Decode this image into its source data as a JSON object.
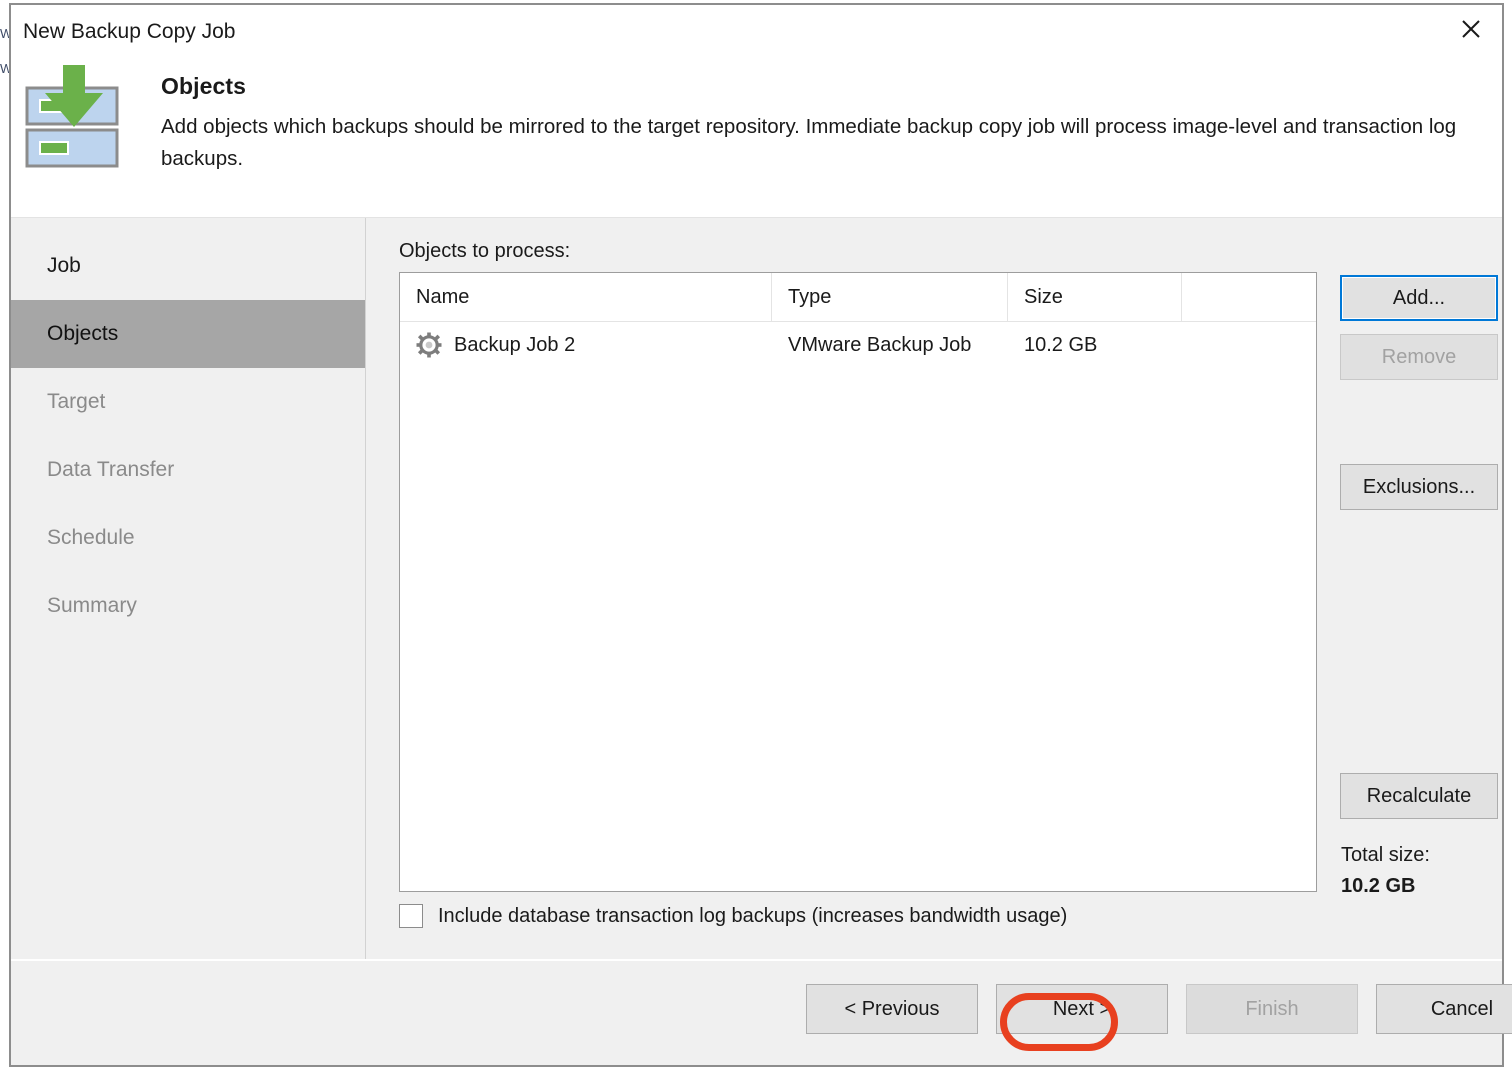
{
  "window": {
    "title": "New Backup Copy Job",
    "close_icon": "close-icon"
  },
  "header": {
    "icon": "backup-repository-download-icon",
    "title": "Objects",
    "description": "Add objects which backups should be mirrored to the target repository. Immediate backup copy job will process image-level and transaction log backups."
  },
  "sidebar": {
    "items": [
      {
        "label": "Job",
        "state": "done"
      },
      {
        "label": "Objects",
        "state": "active"
      },
      {
        "label": "Target",
        "state": "upcoming"
      },
      {
        "label": "Data Transfer",
        "state": "upcoming"
      },
      {
        "label": "Schedule",
        "state": "upcoming"
      },
      {
        "label": "Summary",
        "state": "upcoming"
      }
    ]
  },
  "main": {
    "objects_label": "Objects to process:",
    "table": {
      "columns": [
        "Name",
        "Type",
        "Size",
        ""
      ],
      "rows": [
        {
          "icon": "gear-icon",
          "name": "Backup Job 2",
          "type": "VMware Backup Job",
          "size": "10.2 GB"
        }
      ]
    },
    "buttons": {
      "add": "Add...",
      "remove": "Remove",
      "exclusions": "Exclusions...",
      "recalculate": "Recalculate"
    },
    "total": {
      "label": "Total size:",
      "value": "10.2 GB"
    },
    "checkbox": {
      "label": "Include database transaction log backups (increases bandwidth usage)",
      "checked": false
    }
  },
  "footer": {
    "previous": "< Previous",
    "next": "Next >",
    "finish": "Finish",
    "cancel": "Cancel"
  },
  "annotation": {
    "target": "Next >",
    "color": "#e8401f"
  },
  "colors": {
    "accent_focus": "#0078d7",
    "icon_green": "#6bb14a",
    "icon_blue": "#bdd4ee",
    "sidebar_active_bg": "#a6a6a6",
    "body_bg": "#f0f0f0",
    "annotation_red": "#e8401f"
  }
}
